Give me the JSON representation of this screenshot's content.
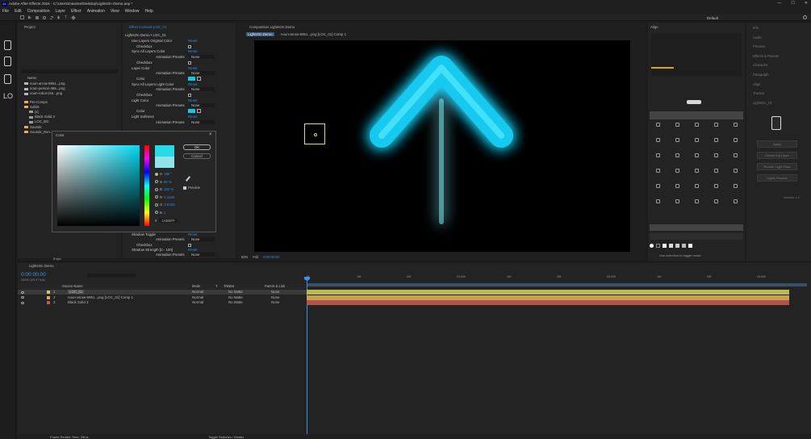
{
  "app": {
    "title": "Adobe After Effects 2024 - C:\\Users\\maxime\\Desktop\\LightsOn Demo.aep *",
    "window_controls": [
      "—",
      "☐",
      "✕"
    ]
  },
  "menu": [
    "File",
    "Edit",
    "Composition",
    "Layer",
    "Effect",
    "Animation",
    "View",
    "Window",
    "Help"
  ],
  "toolbar": {
    "workspace": "Default"
  },
  "left_strip": {
    "label": "LO"
  },
  "project": {
    "title": "Project",
    "column_name": "Name",
    "items": [
      {
        "name": "noun-arrow-6951...png",
        "color": "#b7b7b7"
      },
      {
        "name": "noun-person-465...png",
        "color": "#b7b7b7"
      },
      {
        "name": "noun-robot-216...png",
        "color": "#b7b7b7"
      },
      {
        "name": "Pre-Comps",
        "color": "#d9b45a"
      },
      {
        "name": "Solids",
        "color": "#d9b45a"
      },
      {
        "name": "[x]",
        "color": "#9c9c9c"
      },
      {
        "name": "Black Solid 3",
        "color": "#9c9c9c"
      },
      {
        "name": "LOC_BG",
        "color": "#9c9c9c"
      },
      {
        "name": "Sounds",
        "color": "#d9b45a"
      },
      {
        "name": "Sounds_Ren...",
        "color": "#d9b45a"
      }
    ],
    "footer": "8 bpc"
  },
  "effects": {
    "title": "Effect Controls LOC_01",
    "subtitle": "LightsOn Demo • LOC_01",
    "rows": [
      {
        "label": "Use Layers Original Color",
        "value": "Reset"
      },
      {
        "label": "Checkbox",
        "value": ""
      },
      {
        "label": "Sync All Layers Color",
        "value": "Reset"
      },
      {
        "label": "Animation Presets",
        "value": "None"
      },
      {
        "label": "Checkbox",
        "value": ""
      },
      {
        "label": "Layer Color",
        "value": "Reset"
      },
      {
        "label": "Animation Presets",
        "value": "None"
      },
      {
        "label": "Color",
        "value": ""
      },
      {
        "label": "Sync All Layers Light Color",
        "value": "Reset"
      },
      {
        "label": "Animation Presets",
        "value": "None"
      },
      {
        "label": "Checkbox",
        "value": ""
      },
      {
        "label": "Light Color",
        "value": "Reset"
      },
      {
        "label": "Animation Presets",
        "value": "None"
      },
      {
        "label": "Color",
        "value": ""
      },
      {
        "label": "Light Softness",
        "value": "Reset"
      },
      {
        "label": "Animation Presets",
        "value": "None"
      }
    ],
    "bottom_rows": [
      {
        "label": "Shadow Toggle",
        "value": "Reset"
      },
      {
        "label": "Animation Presets",
        "value": "None"
      },
      {
        "label": "Checkbox",
        "value": ""
      },
      {
        "label": "Shadow Strength [0 - 100]",
        "value": "Reset"
      },
      {
        "label": "Animation Presets",
        "value": "None"
      }
    ]
  },
  "color_dialog": {
    "title": "Color",
    "ok": "OK",
    "cancel": "Cancel",
    "fields": [
      {
        "name": "H",
        "value": "186 °"
      },
      {
        "name": "S",
        "value": "86 %"
      },
      {
        "name": "B",
        "value": "100 %"
      },
      {
        "name": "R",
        "value": "0.1020"
      },
      {
        "name": "G",
        "value": "0.9333"
      },
      {
        "name": "B",
        "value": "1"
      }
    ],
    "hex": "1AEEFF",
    "preview": "Preview",
    "colors": {
      "current": "#26d9e6",
      "original": "#8fe4ea"
    }
  },
  "viewer": {
    "title": "Composition LightsOn Demo",
    "tabs": [
      "LightsOn Demo",
      "noun-arrow-6951...png [LOC_01] Comp 1"
    ],
    "zoom": "50%",
    "resolution": "Full",
    "timecode": "0:00:00:00",
    "glow_color": "#19e1ff"
  },
  "right_panel": {
    "title": "Align",
    "sections": [
      "Info",
      "Audio",
      "Preview",
      "Effects & Presets",
      "Libraries",
      "Paragraph",
      "Tracker"
    ],
    "hint": "Use selection to toggle mode"
  },
  "far_right": {
    "items": [
      "Info",
      "Audio",
      "Preview",
      "Effects & Presets",
      "Character",
      "Paragraph",
      "Align",
      "Tracker",
      "LightsOn_01"
    ],
    "buttons": [
      "Apply",
      "Create Adj Layer",
      "Render Light Pass",
      "Lights Presets"
    ],
    "version": "Version 1.0"
  },
  "timeline": {
    "tab": "LightsOn Demo",
    "timecode": "0:00:00:00",
    "fps": "00000 (29.97 fps)",
    "columns": [
      "Source Name",
      "Mode",
      "T",
      "TrkMat",
      "Parent & Link"
    ],
    "layers": [
      {
        "num": "1",
        "name": "LOC_01",
        "mode": "Normal",
        "trk": "No Matte",
        "parent": "None",
        "label": "#cfc66a",
        "bar": "#bcbb51",
        "selected": true
      },
      {
        "num": "2",
        "name": "noun-arrow-6951...png [LOC_01] Comp 1",
        "mode": "Normal",
        "trk": "No Matte",
        "parent": "None",
        "label": "#d9a95a",
        "bar": "#c7a150",
        "selected": false
      },
      {
        "num": "3",
        "name": "Black Solid 3",
        "mode": "Normal",
        "trk": "No Matte",
        "parent": "None",
        "label": "#c45a52",
        "bar": "#b2534d",
        "selected": false
      }
    ],
    "ruler": [
      "0f",
      "10f",
      "20f",
      "01:00f",
      "10f",
      "20f",
      "02:00f",
      "10f",
      "20f",
      "03:00f"
    ],
    "footer_left": "Frame Render Time: 33ms",
    "footer_right": "Toggle Switches / Modes"
  }
}
